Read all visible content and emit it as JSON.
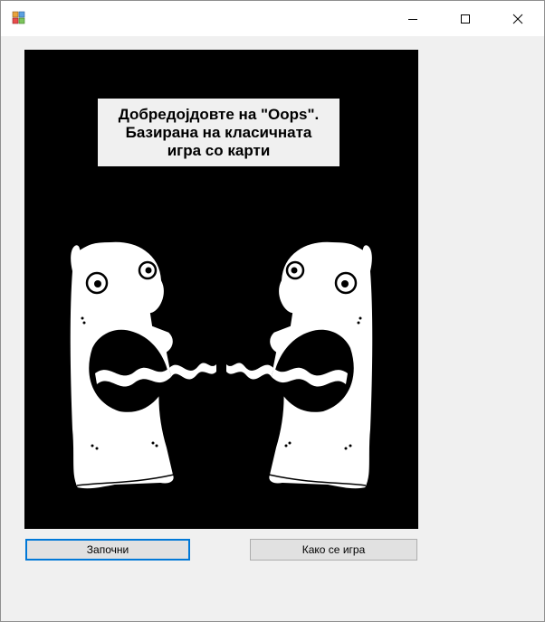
{
  "window": {
    "icon": "winforms-app-icon",
    "controls": {
      "minimize_icon": "minimize-icon",
      "maximize_icon": "maximize-icon",
      "close_icon": "close-icon"
    }
  },
  "picture": {
    "background": "#000000",
    "illustration": "two-screaming-monsters"
  },
  "welcome_label": "Добредојдовте на \"Oops\".\nБазирана на класичната\nигра со карти",
  "buttons": {
    "start_label": "Започни",
    "how_to_play_label": "Како се игра"
  },
  "colors": {
    "focus_border": "#0078d7",
    "button_bg": "#e1e1e1",
    "window_bg": "#f0f0f0"
  }
}
